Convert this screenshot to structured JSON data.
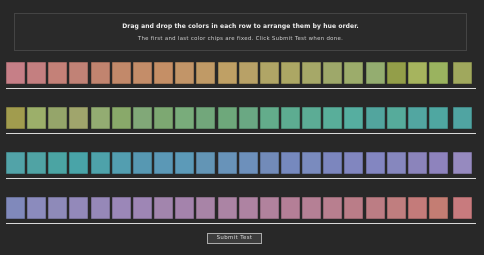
{
  "instructions": {
    "line1": "Drag and drop the colors in each row to arrange them by hue order.",
    "line2": "The first and last color chips are fixed. Click Submit Test when done."
  },
  "submit_label": "Submit Test",
  "rows": [
    [
      "#c67f87",
      "#c47f80",
      "#c48178",
      "#c18276",
      "#c1846f",
      "#c2896a",
      "#c48d69",
      "#c58f66",
      "#c29568",
      "#c09a66",
      "#bfa065",
      "#b8a167",
      "#b0a566",
      "#aca764",
      "#a6a868",
      "#9ea86a",
      "#9cac6b",
      "#94ad70",
      "#939e49",
      "#a6b45e",
      "#9ab35f",
      "#a0a85d"
    ],
    [
      "#a19c4e",
      "#9caf6a",
      "#95a56a",
      "#a0a56c",
      "#93ac72",
      "#89a96a",
      "#81a878",
      "#7da872",
      "#79ac7b",
      "#72a77b",
      "#6ea87b",
      "#6aa883",
      "#63ac8b",
      "#5dac91",
      "#5cac95",
      "#59ae9a",
      "#56aea0",
      "#52a59e",
      "#56ab9b",
      "#52a6a1",
      "#4fa7a1",
      "#50a4a2"
    ],
    [
      "#52a3a8",
      "#50a3a4",
      "#4ba4a3",
      "#49a4a8",
      "#4ea2aa",
      "#539eb0",
      "#5798b2",
      "#5b98b6",
      "#5c9ab8",
      "#6395b5",
      "#6893b9",
      "#6d90bb",
      "#728bb9",
      "#7689be",
      "#7a8bbe",
      "#7c86be",
      "#8186bf",
      "#8386c1",
      "#8687be",
      "#8b84bb",
      "#8e83bd",
      "#968abf"
    ],
    [
      "#8089bb",
      "#8b8bbd",
      "#8e8ab9",
      "#9389ba",
      "#9688b8",
      "#9b87b8",
      "#9e86b5",
      "#a285ad",
      "#a483ac",
      "#a884a7",
      "#ab84a4",
      "#ae83a2",
      "#b1829d",
      "#b47f97",
      "#b58095",
      "#b87f8f",
      "#ba7d88",
      "#bc7d84",
      "#c07e7f",
      "#c47b7a",
      "#c47d73",
      "#c87b7e"
    ]
  ]
}
